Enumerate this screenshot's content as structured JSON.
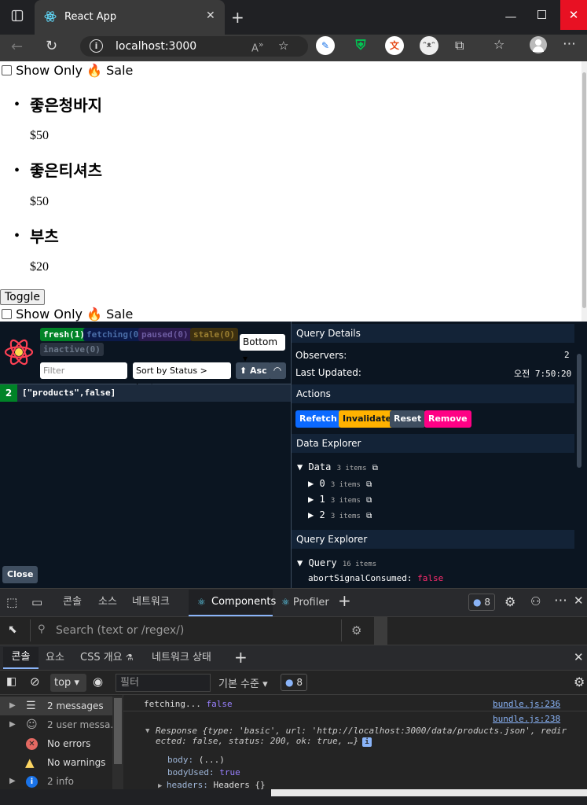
{
  "browser": {
    "tab_title": "React App",
    "address": "localhost:3000",
    "window_controls": [
      "minimize",
      "maximize",
      "close"
    ]
  },
  "page": {
    "checkbox_label_prefix": "Show Only",
    "checkbox_emoji": "🔥",
    "checkbox_label_suffix": "Sale",
    "products": [
      {
        "name": "좋은청바지",
        "price": "$50"
      },
      {
        "name": "좋은티셔츠",
        "price": "$50"
      },
      {
        "name": "부츠",
        "price": "$20"
      }
    ],
    "toggle_label": "Toggle"
  },
  "rq_devtools": {
    "badges": [
      {
        "label": "fresh",
        "count": "(1)",
        "color": "#008327"
      },
      {
        "label": "fetching",
        "count": "(0)",
        "color": "#0b1a4a"
      },
      {
        "label": "paused",
        "count": "(0)",
        "color": "#2b1a4e"
      },
      {
        "label": "stale",
        "count": "(0)",
        "color": "#3d300f"
      },
      {
        "label": "inactive",
        "count": "(0)",
        "color": "#2a3340"
      }
    ],
    "position_select": "Bottom",
    "filter_placeholder": "Filter",
    "sort_select": "Sort by Status > Last",
    "asc_label": "⬆ Asc",
    "query_row": {
      "observers": "2",
      "key": "[\"products\",false]"
    },
    "close_label": "Close",
    "details": {
      "header": "Query Details",
      "observers_label": "Observers:",
      "observers_value": "2",
      "updated_label": "Last Updated:",
      "updated_value": "오전 7:50:20"
    },
    "actions": {
      "header": "Actions",
      "buttons": [
        {
          "label": "Refetch",
          "color": "#0b69ff"
        },
        {
          "label": "Invalidate",
          "color": "#ffb200"
        },
        {
          "label": "Reset",
          "color": "#3f4e60"
        },
        {
          "label": "Remove",
          "color": "#ff0085"
        }
      ]
    },
    "data_explorer": {
      "header": "Data Explorer",
      "root_label": "Data",
      "root_count": "3 items",
      "children": [
        {
          "label": "0",
          "count": "3 items"
        },
        {
          "label": "1",
          "count": "3 items"
        },
        {
          "label": "2",
          "count": "3 items"
        }
      ]
    },
    "query_explorer": {
      "header": "Query Explorer",
      "root_label": "Query",
      "root_count": "16 items",
      "first_key": "abortSignalConsumed:",
      "first_value": "false"
    }
  },
  "devtools": {
    "tabs": [
      "콘솔",
      "소스",
      "네트워크",
      "Components",
      "Profiler"
    ],
    "issues_count": "8",
    "search_placeholder": "Search (text or /regex/)",
    "drawer_tabs": [
      "콘솔",
      "요소",
      "CSS 개요",
      "네트워크 상태"
    ],
    "context": "top",
    "filter_placeholder": "필터",
    "level": "기본 수준",
    "sidebar": [
      {
        "label": "2 messages",
        "icon": "list-icon"
      },
      {
        "label": "2 user messa...",
        "icon": "user-icon"
      },
      {
        "label": "No errors",
        "icon": "error-icon"
      },
      {
        "label": "No warnings",
        "icon": "warning-icon"
      },
      {
        "label": "2 info",
        "icon": "info-icon"
      }
    ],
    "log_lines": [
      {
        "text": "fetching... ",
        "value": "false",
        "source": "bundle.js:236"
      },
      {
        "source": "bundle.js:238"
      }
    ],
    "response_line1": "Response {type: 'basic', url: 'http://localhost:3000/data/products.json', redir",
    "response_line2": "ected: false, status: 200, ok: true, …}",
    "response_props": [
      {
        "key": "body:",
        "value": "(...)"
      },
      {
        "key": "bodyUsed:",
        "value": "true"
      },
      {
        "key": "headers:",
        "value": "Headers {}"
      }
    ]
  }
}
